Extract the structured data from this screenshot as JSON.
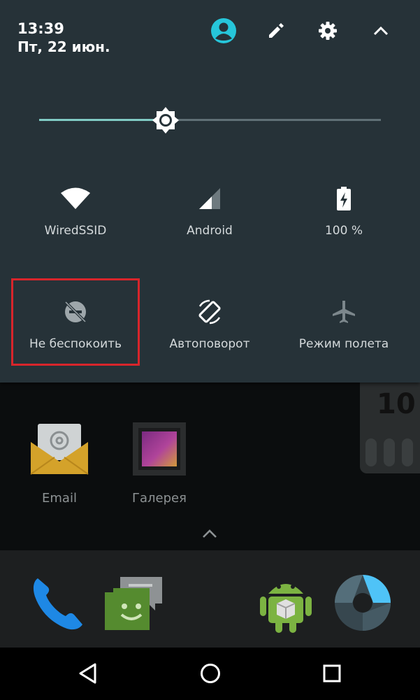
{
  "status": {
    "time": "13:39",
    "date": "Пт, 22 июн."
  },
  "header_icons": [
    "account-icon",
    "edit-pencil-icon",
    "settings-gear-icon",
    "collapse-chevron-up-icon"
  ],
  "brightness": {
    "level_fraction": 0.37,
    "icon": "brightness-icon"
  },
  "tiles_row1": [
    {
      "label": "WiredSSID",
      "icon": "wifi-icon"
    },
    {
      "label": "Android",
      "icon": "cell-signal-icon"
    },
    {
      "label": "100 %",
      "icon": "battery-charging-icon"
    }
  ],
  "tiles_row2": [
    {
      "label": "Не беспокоить",
      "icon": "do-not-disturb-icon"
    },
    {
      "label": "Автоповорот",
      "icon": "auto-rotate-icon"
    },
    {
      "label": "Режим полета",
      "icon": "airplane-mode-icon"
    }
  ],
  "home": {
    "widget_number": "10",
    "apps": [
      {
        "label": "Email",
        "icon": "email-icon"
      },
      {
        "label": "Галерея",
        "icon": "gallery-icon"
      }
    ]
  },
  "dock_icons": [
    "phone-icon",
    "messenger-icon",
    "android-market-icon",
    "camera-icon"
  ],
  "nav_icons": [
    "back-icon",
    "home-icon",
    "recents-icon"
  ],
  "colors": {
    "panel": "#263238",
    "accent": "#80cbc4",
    "avatar": "#26c6da",
    "highlight_border": "#d8252b"
  }
}
